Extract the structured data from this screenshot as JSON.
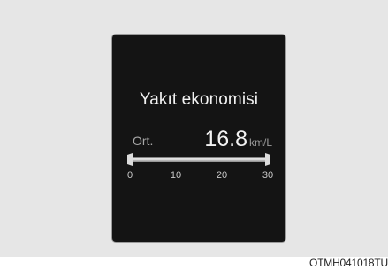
{
  "display": {
    "title": "Yakıt ekonomisi",
    "average_label": "Ort.",
    "value": "16.8",
    "unit": "km/L",
    "scale": {
      "ticks": [
        "0",
        "10",
        "20",
        "30"
      ],
      "min": 0,
      "max": 30
    }
  },
  "caption": "OTMH041018TU"
}
